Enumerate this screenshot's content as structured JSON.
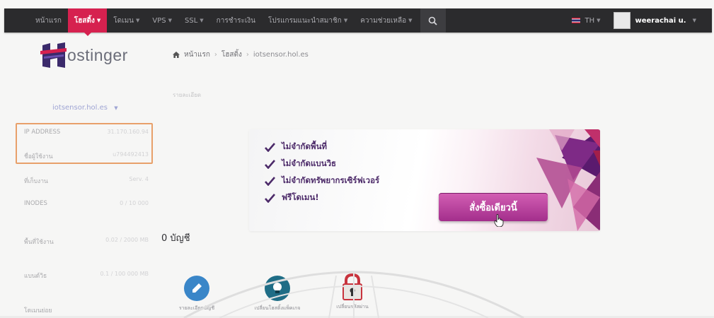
{
  "nav": {
    "items": [
      {
        "label": "หน้าแรก",
        "dropdown": false,
        "active": false
      },
      {
        "label": "โฮสติ้ง",
        "dropdown": true,
        "active": true
      },
      {
        "label": "โดเมน",
        "dropdown": true,
        "active": false
      },
      {
        "label": "VPS",
        "dropdown": true,
        "active": false
      },
      {
        "label": "SSL",
        "dropdown": true,
        "active": false
      },
      {
        "label": "การชำระเงิน",
        "dropdown": false,
        "active": false
      },
      {
        "label": "โปรแกรมแนะนำสมาชิก",
        "dropdown": true,
        "active": false
      },
      {
        "label": "ความช่วยเหลือ",
        "dropdown": true,
        "active": false
      }
    ],
    "language": "TH",
    "user": "weerachai u."
  },
  "logo": {
    "text": "ostinger"
  },
  "breadcrumb": {
    "home": "หน้าแรก",
    "hosting": "โฮสติ้ง",
    "current": "iotsensor.hol.es"
  },
  "faint_label": "รายละเอียด",
  "sidebar": {
    "domain": "iotsensor.hol.es",
    "rows": [
      {
        "label": "IP ADDRESS",
        "value": "31.170.160.94"
      },
      {
        "label": "ชื่อผู้ใช้งาน",
        "value": "u794492413"
      },
      {
        "label": "ที่เก็บงาน",
        "value": "Serv. 4"
      },
      {
        "label": "INODES",
        "value": "0 / 10 000"
      },
      {
        "label": "พื้นที่ใช้งาน",
        "value": "0.02 / 2000 MB"
      },
      {
        "label": "แบนด์วิธ",
        "value": "0.1 / 100 000 MB"
      },
      {
        "label": "โดเมนย่อย",
        "value": ""
      }
    ]
  },
  "promo": {
    "items": [
      "ไม่จำกัดพื้นที่",
      "ไม่จำกัดแบนวิธ",
      "ไม่จำกัดทรัพยากรเซิร์ฟเวอร์",
      "ฟรีโดเมน!"
    ],
    "cta": "สั่งซื้อเดียวนี้"
  },
  "accounts": {
    "text": "0 บัญชี"
  },
  "tools": [
    {
      "label": "รายละเอียดบัญชี",
      "icon": "info-icon",
      "color": "#3a86c8"
    },
    {
      "label": "เปลี่ยนโฮสติ้งแพ็คเกจ",
      "icon": "lightbulb-icon",
      "color": "#1f6d86"
    },
    {
      "label": "เปลี่ยนรหัสผ่าน",
      "icon": "lock-icon",
      "color": "#c8343e"
    }
  ],
  "colors": {
    "nav_bg": "#2b2b2d",
    "active_tab": "#d6214f",
    "cta": "#b53d98",
    "highlight_border": "#e8a06a"
  }
}
